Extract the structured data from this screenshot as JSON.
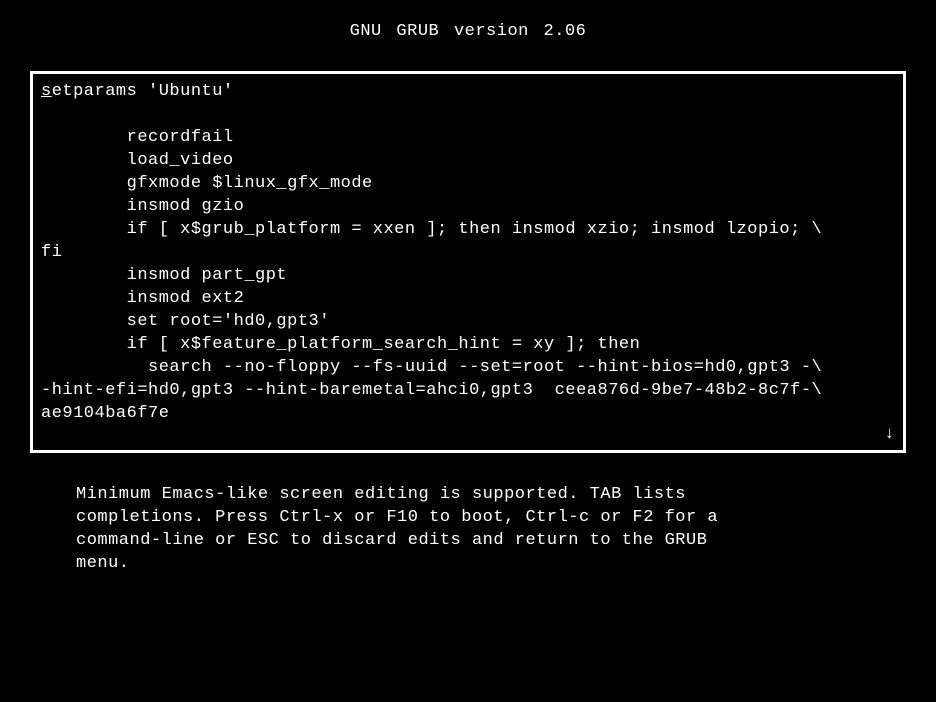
{
  "header": {
    "title": "GNU GRUB  version 2.06"
  },
  "editor": {
    "first_char": "s",
    "line1_rest": "etparams 'Ubuntu'",
    "line2": "",
    "line3": "        recordfail",
    "line4": "        load_video",
    "line5": "        gfxmode $linux_gfx_mode",
    "line6": "        insmod gzio",
    "line7": "        if [ x$grub_platform = xxen ]; then insmod xzio; insmod lzopio; \\",
    "line8": "fi",
    "line9": "        insmod part_gpt",
    "line10": "        insmod ext2",
    "line11": "        set root='hd0,gpt3'",
    "line12": "        if [ x$feature_platform_search_hint = xy ]; then",
    "line13": "          search --no-floppy --fs-uuid --set=root --hint-bios=hd0,gpt3 -\\",
    "line14": "-hint-efi=hd0,gpt3 --hint-baremetal=ahci0,gpt3  ceea876d-9be7-48b2-8c7f-\\",
    "line15": "ae9104ba6f7e",
    "scroll_indicator": "↓"
  },
  "help": {
    "text": "Minimum Emacs-like screen editing is supported. TAB lists\ncompletions. Press Ctrl-x or F10 to boot, Ctrl-c or F2 for a\ncommand-line or ESC to discard edits and return to the GRUB\nmenu."
  }
}
